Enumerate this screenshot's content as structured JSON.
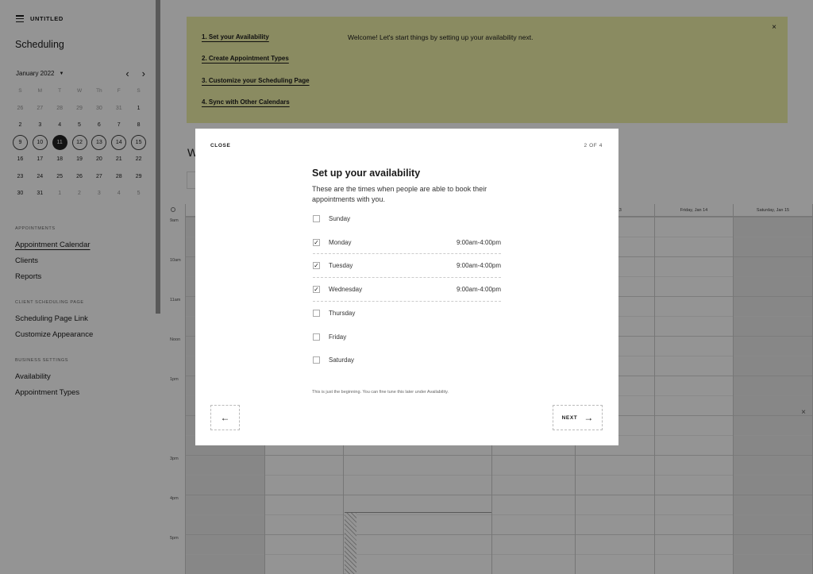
{
  "sidebar": {
    "untitled_label": "UNTITLED",
    "title": "Scheduling",
    "month_label": "January 2022",
    "prev_icon": "chevron-left-icon",
    "next_icon": "chevron-right-icon",
    "weekdays": [
      "S",
      "M",
      "T",
      "W",
      "Th",
      "F",
      "S"
    ],
    "weeks": [
      [
        "26",
        "27",
        "28",
        "29",
        "30",
        "31",
        "1"
      ],
      [
        "2",
        "3",
        "4",
        "5",
        "6",
        "7",
        "8"
      ],
      [
        "9",
        "10",
        "11",
        "12",
        "13",
        "14",
        "15"
      ],
      [
        "16",
        "17",
        "18",
        "19",
        "20",
        "21",
        "22"
      ],
      [
        "23",
        "24",
        "25",
        "26",
        "27",
        "28",
        "29"
      ],
      [
        "30",
        "31",
        "1",
        "2",
        "3",
        "4",
        "5"
      ]
    ],
    "sections": {
      "appointments": "APPOINTMENTS",
      "client_page": "CLIENT SCHEDULING PAGE",
      "business": "BUSINESS SETTINGS"
    },
    "links": {
      "appointment_calendar": "Appointment Calendar",
      "clients": "Clients",
      "reports": "Reports",
      "scheduling_page_link": "Scheduling Page Link",
      "customize_appearance": "Customize Appearance",
      "availability": "Availability",
      "appointment_types": "Appointment Types"
    }
  },
  "banner": {
    "steps": [
      "1. Set your Availability",
      "2. Create Appointment Types",
      "3. Customize your Scheduling Page",
      "4. Sync with Other Calendars"
    ],
    "welcome": "Welcome! Let's start things by setting up your availability next.",
    "close": "×"
  },
  "calendar": {
    "title_partial": "W",
    "day_headers": [
      "",
      "",
      "",
      "",
      "Jan 13",
      "Friday, Jan 14",
      "Saturday, Jan 15"
    ],
    "times": [
      "9am",
      "10am",
      "11am",
      "Noon",
      "1pm",
      "",
      "3pm",
      "4pm",
      "5pm"
    ]
  },
  "toast": {
    "close": "×"
  },
  "modal": {
    "close_label": "CLOSE",
    "step_label": "2 OF 4",
    "title": "Set up your availability",
    "subtitle": "These are the times when people are able to book their appointments with you.",
    "days": [
      {
        "name": "Sunday",
        "checked": false,
        "hours": ""
      },
      {
        "name": "Monday",
        "checked": true,
        "hours": "9:00am-4:00pm"
      },
      {
        "name": "Tuesday",
        "checked": true,
        "hours": "9:00am-4:00pm"
      },
      {
        "name": "Wednesday",
        "checked": true,
        "hours": "9:00am-4:00pm"
      },
      {
        "name": "Thursday",
        "checked": false,
        "hours": ""
      },
      {
        "name": "Friday",
        "checked": false,
        "hours": ""
      },
      {
        "name": "Saturday",
        "checked": false,
        "hours": ""
      }
    ],
    "footer_note": "This is just the beginning. You can fine tune this later under Availability.",
    "back_icon": "arrow-left-icon",
    "next_label": "NEXT",
    "next_icon": "arrow-right-icon"
  }
}
